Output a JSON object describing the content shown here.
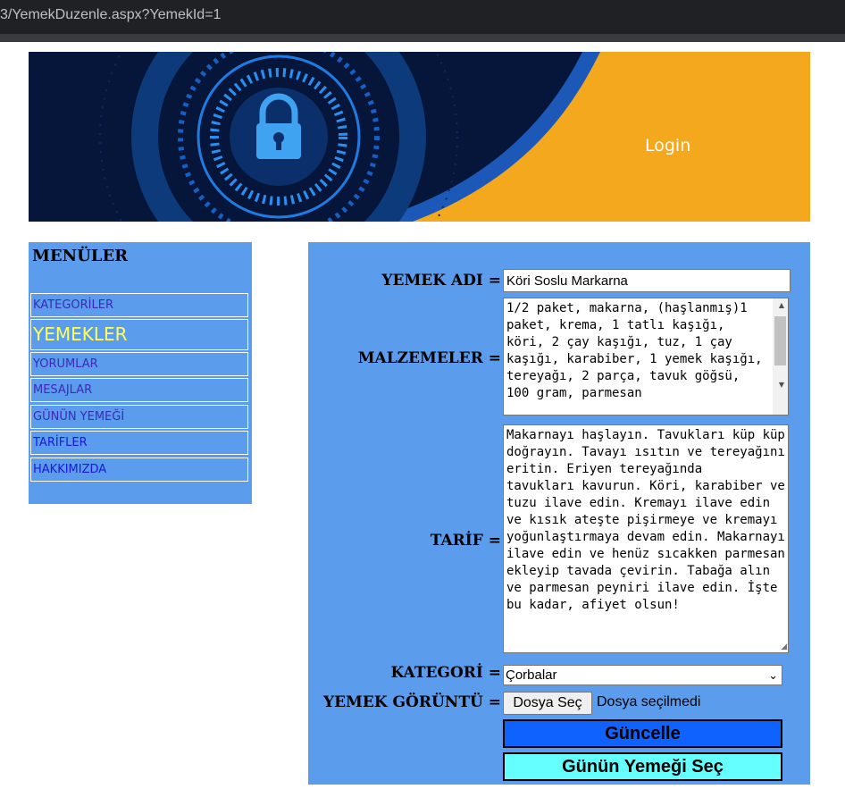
{
  "browser": {
    "url": "3/YemekDuzenle.aspx?YemekId=1"
  },
  "banner": {
    "login_text": "Login",
    "icon": "lock-icon"
  },
  "sidebar": {
    "title": "MENÜLER",
    "items": [
      {
        "label": "KATEGORİLER"
      },
      {
        "label": "YEMEKLER"
      },
      {
        "label": "YORUMLAR"
      },
      {
        "label": "MESAJLAR"
      },
      {
        "label": "GÜNÜN YEMEĞİ"
      },
      {
        "label": "TARİFLER"
      },
      {
        "label": "HAKKIMIZDA"
      }
    ]
  },
  "form": {
    "name_label": "YEMEK ADI =",
    "name_value": "Köri Soslu Markarna",
    "ingredients_label": "MALZEMELER =",
    "ingredients_value": "1/2 paket, makarna, (haşlanmış)1 paket, krema, 1 tatlı kaşığı, köri, 2 çay kaşığı, tuz, 1 çay kaşığı, karabiber, 1 yemek kaşığı, tereyağı, 2 parça, tavuk göğsü, 100 gram, parmesan",
    "recipe_label": "TARİF =",
    "recipe_value": "Makarnayı haşlayın. Tavukları küp küp doğrayın. Tavayı ısıtın ve tereyağını eritin. Eriyen tereyağında\ntavukları kavurun. Köri, karabiber ve tuzu ilave edin. Kremayı ilave edin ve kısık ateşte pişirmeye ve kremayı yoğunlaştırmaya devam edin. Makarnayı ilave edin ve henüz sıcakken parmesan ekleyip tavada çevirin. Tabağa alın ve parmesan peyniri ilave edin. İşte bu kadar, afiyet olsun!",
    "category_label": "KATEGORİ =",
    "category_value": "Çorbalar",
    "image_label": "YEMEK GÖRÜNTÜ =",
    "file_button": "Dosya Seç",
    "file_status": "Dosya seçilmedi",
    "update_button": "Güncelle",
    "daily_button": "Günün Yemeği Seç"
  },
  "colors": {
    "panel_bg": "#5b9cec",
    "update_button_bg": "#0f62fe",
    "daily_button_bg": "#66ffff",
    "banner_orange": "#f4a81d",
    "banner_navy": "#06163a"
  }
}
